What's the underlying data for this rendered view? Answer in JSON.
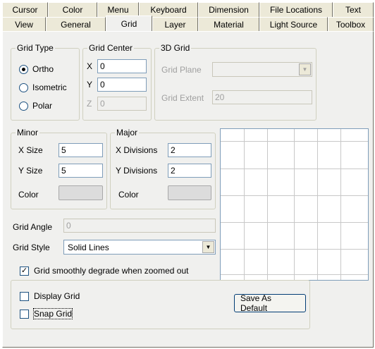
{
  "tabs": {
    "row1": [
      "Cursor",
      "Color",
      "Menu",
      "Keyboard",
      "Dimension",
      "File Locations",
      "Text"
    ],
    "row2": [
      "View",
      "General",
      "Grid",
      "Layer",
      "Material",
      "Light Source",
      "Toolbox"
    ],
    "active": "Grid"
  },
  "grid_type": {
    "legend": "Grid Type",
    "options": [
      "Ortho",
      "Isometric",
      "Polar"
    ],
    "selected": "Ortho"
  },
  "grid_center": {
    "legend": "Grid Center",
    "x_label": "X",
    "x_value": "0",
    "y_label": "Y",
    "y_value": "0",
    "z_label": "Z",
    "z_value": "0"
  },
  "grid_3d": {
    "legend": "3D Grid",
    "plane_label": "Grid Plane",
    "plane_value": "",
    "extent_label": "Grid Extent",
    "extent_value": "20"
  },
  "minor": {
    "legend": "Minor",
    "x_label": "X Size",
    "x_value": "5",
    "y_label": "Y Size",
    "y_value": "5",
    "color_label": "Color"
  },
  "major": {
    "legend": "Major",
    "x_label": "X Divisions",
    "x_value": "2",
    "y_label": "Y Divisions",
    "y_value": "2",
    "color_label": "Color"
  },
  "grid_angle": {
    "label": "Grid Angle",
    "value": "0"
  },
  "grid_style": {
    "label": "Grid Style",
    "value": "Solid Lines"
  },
  "degrade": {
    "label": "Grid smoothly degrade when zoomed out",
    "checked": true
  },
  "display_grid": {
    "label": "Display Grid",
    "checked": false
  },
  "snap_grid": {
    "label": "Snap Grid",
    "checked": false
  },
  "save_default": {
    "label": "Save As Default"
  },
  "colors": {
    "panel_bg": "#f0f0ee",
    "tab_bg": "#ece9d8",
    "input_border": "#7f9db9",
    "group_border": "#d0d0bf",
    "swatch": "#dcdcdc"
  }
}
